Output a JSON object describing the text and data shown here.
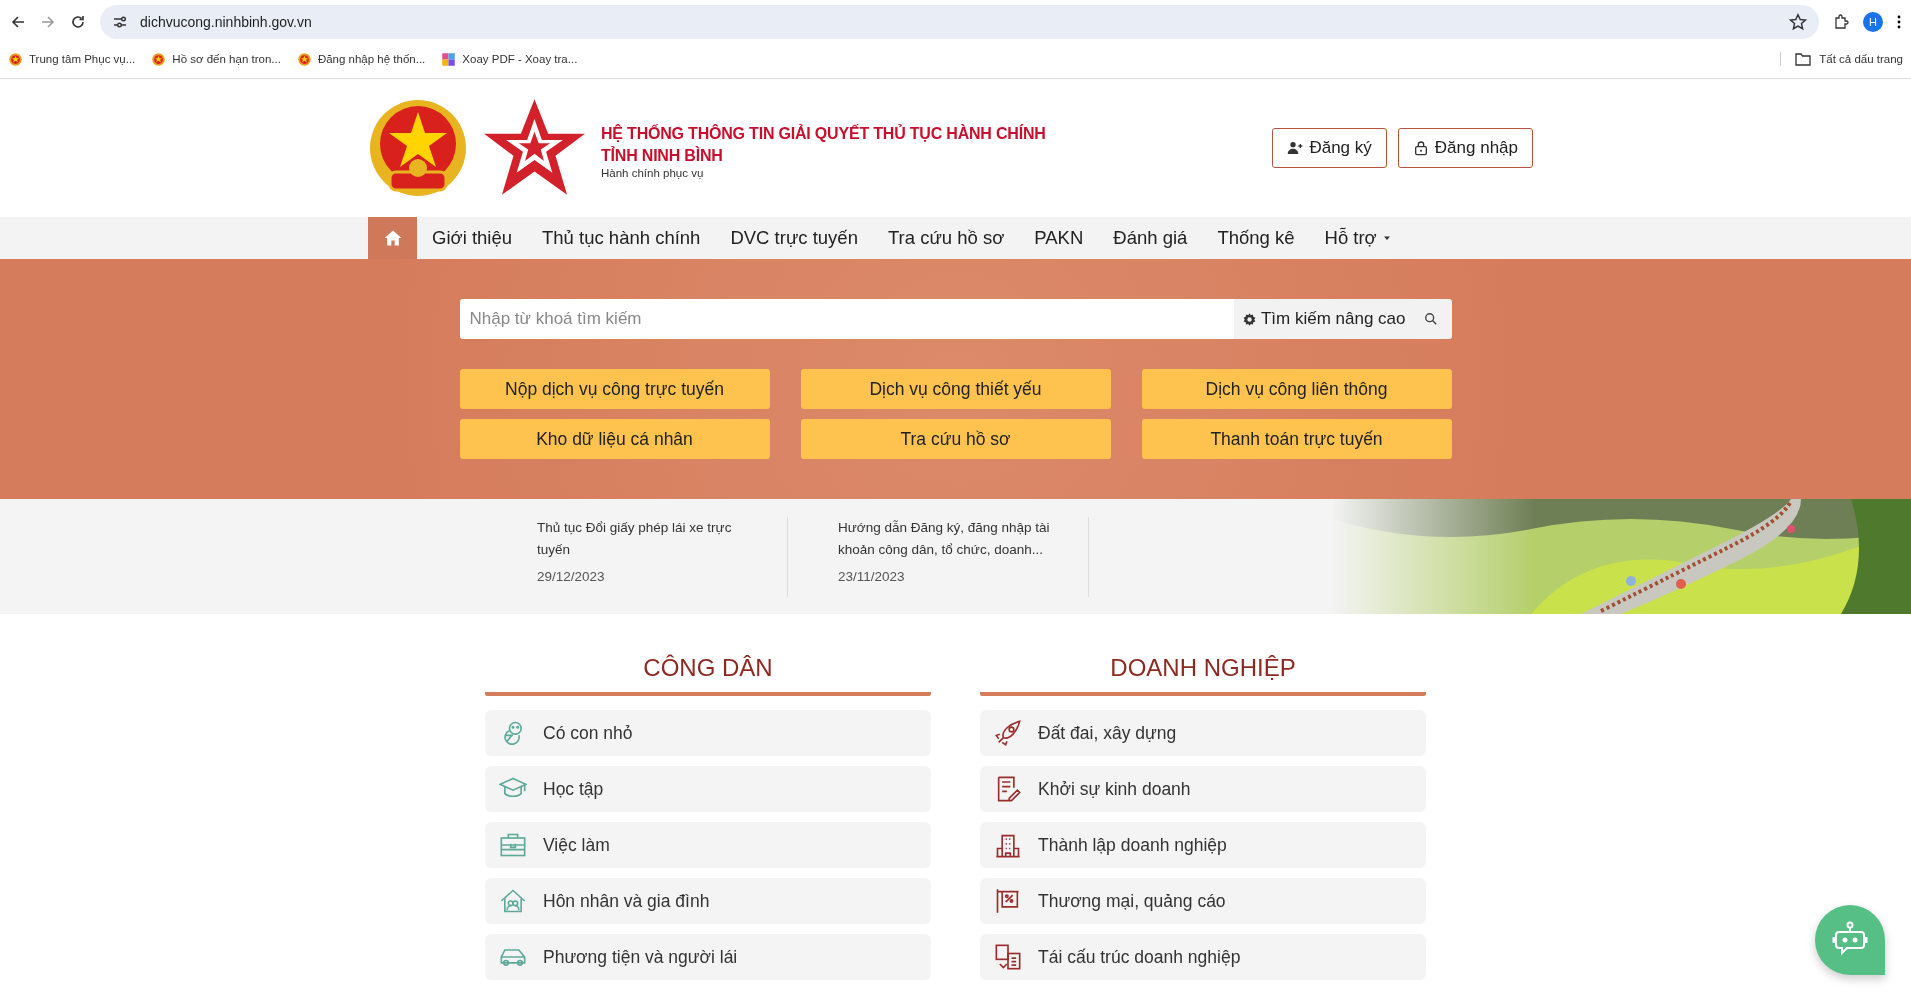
{
  "browser": {
    "url": "dichvucong.ninhbinh.gov.vn",
    "profile_initial": "H",
    "all_bookmarks": "Tất cả dấu trang",
    "bookmarks": [
      "Trung tâm Phục vụ...",
      "Hồ sơ đến hạn tron...",
      "Đăng nhập hệ thốn...",
      "Xoay PDF - Xoay tra..."
    ]
  },
  "header": {
    "title": "HỆ THỐNG THÔNG TIN GIẢI QUYẾT THỦ TỤC HÀNH CHÍNH",
    "subtitle": "TỈNH NINH BÌNH",
    "tagline": "Hành chính phục vụ",
    "buttons": [
      {
        "kind": "register",
        "label": "Đăng ký"
      },
      {
        "kind": "login",
        "label": "Đăng nhập"
      }
    ]
  },
  "nav": [
    {
      "kind": "home",
      "selected": true
    },
    {
      "kind": "link",
      "label": "Giới thiệu",
      "selected": false
    },
    {
      "kind": "link",
      "label": "Thủ tục hành chính",
      "selected": false
    },
    {
      "kind": "link",
      "label": "DVC trực tuyến",
      "selected": false
    },
    {
      "kind": "link",
      "label": "Tra cứu hồ sơ",
      "selected": false
    },
    {
      "kind": "link",
      "label": "PAKN",
      "selected": false
    },
    {
      "kind": "link",
      "label": "Đánh giá",
      "selected": false
    },
    {
      "kind": "link",
      "label": "Thống kê",
      "selected": false
    },
    {
      "kind": "dropdown",
      "label": "Hỗ trợ",
      "selected": false
    }
  ],
  "search": {
    "placeholder": "Nhập từ khoá tìm kiếm",
    "advanced": "Tìm kiếm nâng cao"
  },
  "quick_links": [
    "Nộp dịch vụ công trực tuyến",
    "Dịch vụ công thiết yếu",
    "Dịch vụ công liên thông",
    "Kho dữ liệu cá nhân",
    "Tra cứu hồ sơ",
    "Thanh toán trực tuyến"
  ],
  "news": [
    {
      "title": "Thủ tục Đổi giấy phép lái xe trực tuyến",
      "date": "29/12/2023"
    },
    {
      "title": "Hướng dẫn Đăng ký, đăng nhập tài khoản công dân, tổ chức, doanh...",
      "date": "23/11/2023"
    }
  ],
  "sections": [
    {
      "title": "CÔNG DÂN",
      "color": "#5fa99a",
      "items": [
        "Có con nhỏ",
        "Học tập",
        "Việc làm",
        "Hôn nhân và gia đình",
        "Phương tiện và người lái"
      ]
    },
    {
      "title": "DOANH NGHIỆP",
      "color": "#9b2c2c",
      "items": [
        "Đất đai, xây dựng",
        "Khởi sự kinh doanh",
        "Thành lập doanh nghiệp",
        "Thương mại, quảng cáo",
        "Tái cấu trúc doanh nghiệp"
      ]
    }
  ]
}
